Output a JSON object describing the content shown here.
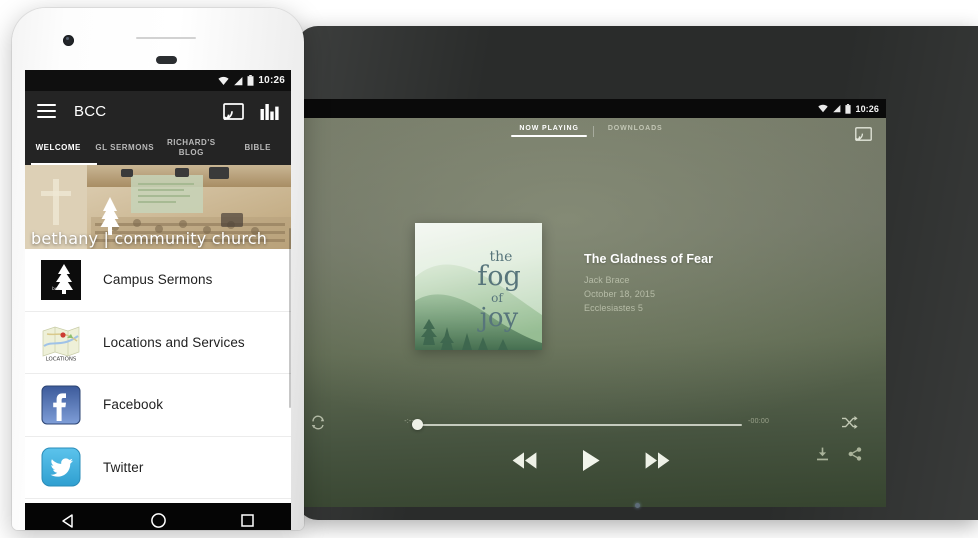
{
  "phone": {
    "status_bar": {
      "time": "10:26",
      "icons": [
        "wifi-icon",
        "signal-icon",
        "battery-icon"
      ]
    },
    "app_bar": {
      "title": "BCC",
      "menu_icon": "hamburger-menu-icon",
      "cast_icon": "cast-icon",
      "equalizer_icon": "equalizer-icon"
    },
    "tabs": [
      {
        "label": "WELCOME",
        "active": true
      },
      {
        "label": "GL SERMONS",
        "active": false
      },
      {
        "label": "RICHARD'S BLOG",
        "active": false
      },
      {
        "label": "BIBLE",
        "active": false
      }
    ],
    "hero": {
      "caption": "bethany | community church",
      "logo": "tree-logo-icon"
    },
    "list_items": [
      {
        "label": "Campus Sermons",
        "icon": "tree-logo-icon"
      },
      {
        "label": "Locations and Services",
        "icon": "map-locations-icon"
      },
      {
        "label": "Facebook",
        "icon": "facebook-icon"
      },
      {
        "label": "Twitter",
        "icon": "twitter-icon"
      }
    ],
    "nav_bar": {
      "back": "back-triangle-icon",
      "home": "home-circle-icon",
      "recents": "recents-square-icon"
    }
  },
  "tablet": {
    "status_bar": {
      "time": "10:26",
      "icons": [
        "wifi-icon",
        "signal-icon",
        "battery-icon"
      ]
    },
    "tabs": [
      {
        "label": "NOW PLAYING",
        "active": true
      },
      {
        "label": "DOWNLOADS",
        "active": false
      }
    ],
    "cast_icon": "cast-icon",
    "now_playing": {
      "album_art_text": {
        "line1": "the",
        "line2": "fog",
        "line3": "of",
        "line4": "joy"
      },
      "title": "The Gladness of Fear",
      "speaker": "Jack Brace",
      "date": "October 18, 2015",
      "scripture": "Ecclesiastes 5"
    },
    "player": {
      "repeat_icon": "repeat-icon",
      "shuffle_icon": "shuffle-icon",
      "rewind_icon": "rewind-icon",
      "play_icon": "play-icon",
      "forward_icon": "fast-forward-icon",
      "download_icon": "download-icon",
      "share_icon": "share-icon",
      "time_elapsed": "-:--",
      "time_total": "-00:00",
      "progress_percent": 0
    }
  },
  "colors": {
    "tablet_bg_top": "#737866",
    "tablet_bg_bottom": "#36442f",
    "phone_appbar": "#242424",
    "accent_white": "#ffffff",
    "facebook_blue": "#3b5998",
    "twitter_blue": "#55acee"
  }
}
